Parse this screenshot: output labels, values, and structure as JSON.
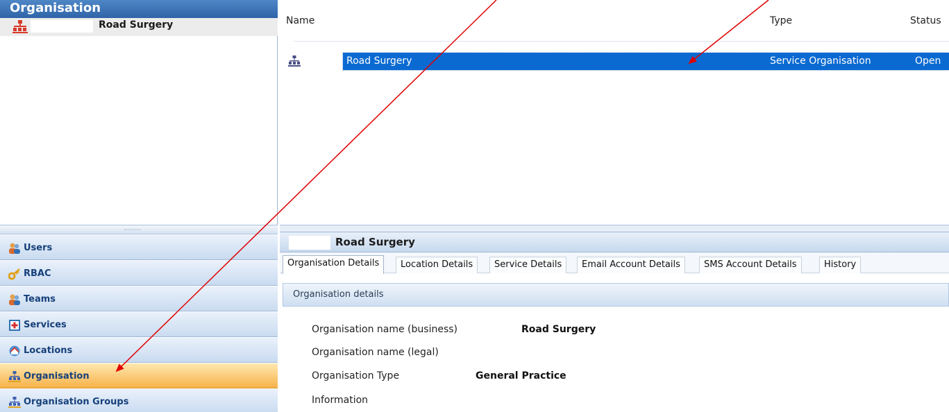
{
  "left_panel": {
    "title": "Organisation",
    "tree_item_label": "Road Surgery",
    "splitter_grip": "··········"
  },
  "nav": [
    {
      "label": "Users",
      "icon": "users-icon"
    },
    {
      "label": "RBAC",
      "icon": "key-icon"
    },
    {
      "label": "Teams",
      "icon": "team-icon"
    },
    {
      "label": "Services",
      "icon": "services-icon"
    },
    {
      "label": "Locations",
      "icon": "locations-icon"
    },
    {
      "label": "Organisation",
      "icon": "organisation-icon",
      "active": true
    },
    {
      "label": "Organisation Groups",
      "icon": "organisation-groups-icon"
    }
  ],
  "list": {
    "columns": {
      "name": "Name",
      "type": "Type",
      "status": "Status"
    },
    "rows": [
      {
        "name": "Road Surgery",
        "type": "Service Organisation",
        "status": "Open",
        "selected": true
      }
    ]
  },
  "detail": {
    "title": "Road Surgery",
    "tabs": [
      "Organisation Details",
      "Location Details",
      "Service Details",
      "Email Account Details",
      "SMS Account Details",
      "History"
    ],
    "active_tab": "Organisation Details",
    "group_header": "Organisation details",
    "fields": [
      {
        "label": "Organisation name (business)",
        "value": "Road Surgery"
      },
      {
        "label": "Organisation name (legal)",
        "value": ""
      },
      {
        "label": "Organisation Type",
        "value": "General Practice"
      },
      {
        "label": "Information",
        "value": ""
      }
    ]
  },
  "colors": {
    "header_blue": "#2f65a8",
    "selection_blue": "#0a6ad1",
    "active_nav_orange": "#f7b24a",
    "annotation_arrow": "#e00000"
  }
}
